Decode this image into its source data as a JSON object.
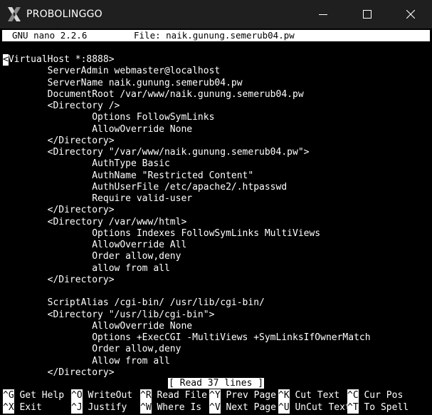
{
  "window": {
    "title": "PROBOLINGGO",
    "app_icon": "x-logo-icon"
  },
  "controls": {
    "minimize_icon": "minimize-icon",
    "maximize_icon": "maximize-icon",
    "close_icon": "close-icon"
  },
  "nano": {
    "version": "GNU nano 2.2.6",
    "file": "File: naik.gunung.semerub04.pw",
    "status": "[ Read 37 lines ]"
  },
  "editor": {
    "cursor_char": "<",
    "lines": [
      "",
      "<VirtualHost *:8888>",
      "        ServerAdmin webmaster@localhost",
      "        ServerName naik.gunung.semerub04.pw",
      "        DocumentRoot /var/www/naik.gunung.semerub04.pw",
      "        <Directory />",
      "                Options FollowSymLinks",
      "                AllowOverride None",
      "        </Directory>",
      "        <Directory \"/var/www/naik.gunung.semerub04.pw\">",
      "                AuthType Basic",
      "                AuthName \"Restricted Content\"",
      "                AuthUserFile /etc/apache2/.htpasswd",
      "                Require valid-user",
      "        </Directory>",
      "        <Directory /var/www/html>",
      "                Options Indexes FollowSymLinks MultiViews",
      "                AllowOverride All",
      "                Order allow,deny",
      "                allow from all",
      "        </Directory>",
      "",
      "        ScriptAlias /cgi-bin/ /usr/lib/cgi-bin/",
      "        <Directory \"/usr/lib/cgi-bin\">",
      "                AllowOverride None",
      "                Options +ExecCGI -MultiViews +SymLinksIfOwnerMatch",
      "                Order allow,deny",
      "                Allow from all",
      "        </Directory>"
    ]
  },
  "shortcuts": {
    "row1": [
      {
        "key": "^G",
        "label": " Get Help"
      },
      {
        "key": "^O",
        "label": " WriteOut"
      },
      {
        "key": "^R",
        "label": " Read File"
      },
      {
        "key": "^Y",
        "label": " Prev Page"
      },
      {
        "key": "^K",
        "label": " Cut Text"
      },
      {
        "key": "^C",
        "label": " Cur Pos"
      }
    ],
    "row2": [
      {
        "key": "^X",
        "label": " Exit"
      },
      {
        "key": "^J",
        "label": " Justify"
      },
      {
        "key": "^W",
        "label": " Where Is"
      },
      {
        "key": "^V",
        "label": " Next Page"
      },
      {
        "key": "^U",
        "label": " UnCut Text"
      },
      {
        "key": "^T",
        "label": " To Spell"
      }
    ]
  },
  "colors": {
    "titlebar_bg": "#1f1f1f",
    "terminal_bg": "#000000",
    "terminal_fg": "#ffffff",
    "inverse_bg": "#ffffff",
    "inverse_fg": "#000000"
  }
}
